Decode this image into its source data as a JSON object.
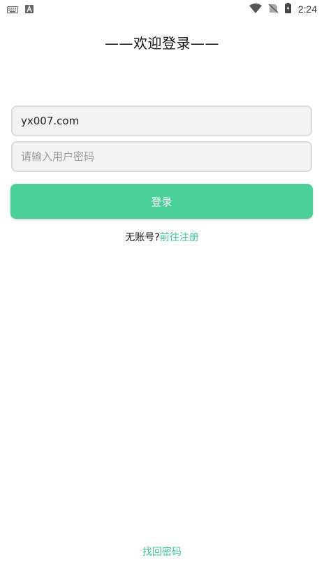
{
  "status_bar": {
    "time": "2:24",
    "icons": [
      "keyboard-icon",
      "font-a-icon",
      "wifi-icon",
      "no-sim-icon",
      "battery-charging-icon"
    ]
  },
  "page": {
    "title": "——欢迎登录——"
  },
  "form": {
    "account_value": "yx007.com",
    "password_placeholder": "请输入用户密码",
    "login_label": "登录"
  },
  "register": {
    "question": "无账号?",
    "link": "前往注册"
  },
  "footer": {
    "forgot_password": "找回密码"
  },
  "colors": {
    "accent": "#4bcf9b",
    "link": "#3ec890",
    "field_bg": "#f3f3f3",
    "field_border": "#dcdcdc"
  }
}
